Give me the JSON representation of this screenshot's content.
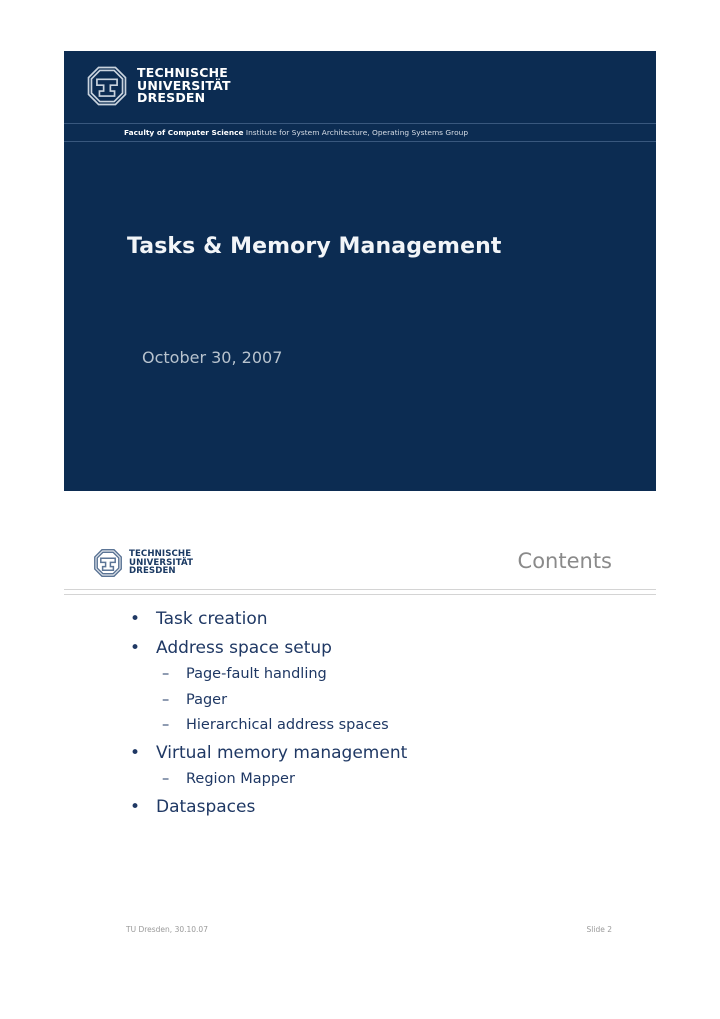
{
  "colors": {
    "slide_background": "#0c2c52",
    "title_text": "#f2f5f8",
    "date_text": "#b8c3ce",
    "content_text": "#1f3864",
    "header_title": "#8a8a8a",
    "footer_text": "#9a9a9a",
    "rule": "#d4d4d4"
  },
  "slide1": {
    "logo": {
      "icon": "tu-dresden-octagon-logo",
      "line1": "TECHNISCHE",
      "line2": "UNIVERSITÄT",
      "line3": "DRESDEN"
    },
    "faculty_bar": {
      "strong": "Faculty of Computer Science",
      "rest": " Institute for System Architecture, Operating Systems Group"
    },
    "title": "Tasks & Memory Management",
    "date": "October 30, 2007"
  },
  "slide2": {
    "logo": {
      "icon": "tu-dresden-octagon-logo",
      "line1": "TECHNISCHE",
      "line2": "UNIVERSITÄT",
      "line3": "DRESDEN"
    },
    "title": "Contents",
    "bullet_symbol": "•",
    "dash_symbol": "–",
    "items": [
      {
        "label": "Task creation",
        "children": []
      },
      {
        "label": "Address space setup",
        "children": [
          "Page-fault handling",
          "Pager",
          "Hierarchical address spaces"
        ]
      },
      {
        "label": "Virtual memory management",
        "children": [
          "Region Mapper"
        ]
      },
      {
        "label": "Dataspaces",
        "children": []
      }
    ],
    "footer": {
      "left": "TU Dresden, 30.10.07",
      "right": "Slide 2"
    }
  }
}
